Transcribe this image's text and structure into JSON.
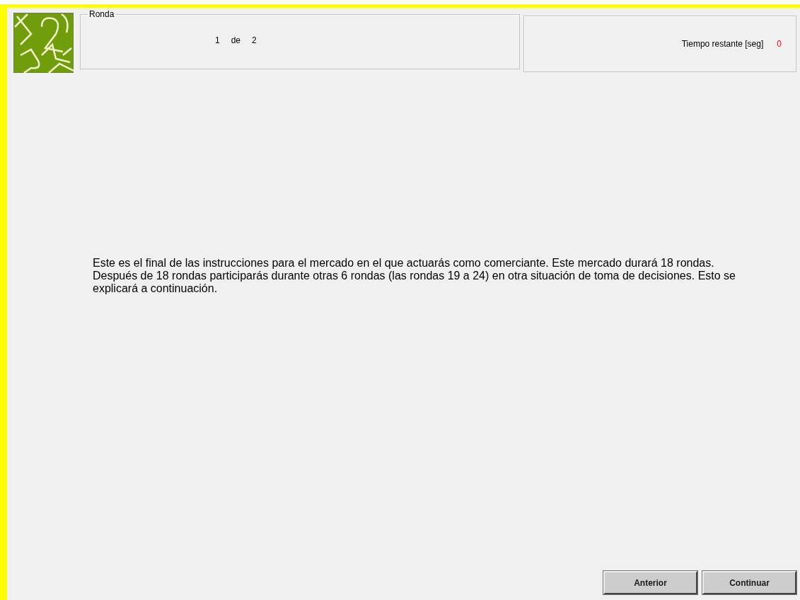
{
  "round_panel": {
    "title": "Ronda",
    "current": "1",
    "separator": "de",
    "total": "2"
  },
  "timer_panel": {
    "label": "Tiempo restante [seg]",
    "value": "0"
  },
  "instructions": "Este es el final de las instrucciones para el mercado en el que actuarás como comerciante. Este mercado durará 18 rondas. Después de 18 rondas participarás durante otras 6 rondas (las rondas 19 a 24) en otra situación de toma de decisiones. Esto se explicará a continuación.",
  "buttons": [
    "Anterior",
    "Continuar"
  ]
}
